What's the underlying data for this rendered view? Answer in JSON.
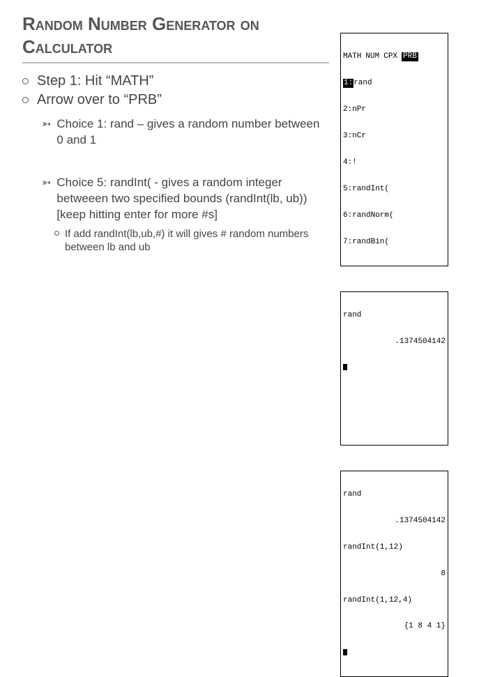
{
  "title": "Random Number Generator on Calculator",
  "steps": [
    "Step 1:  Hit “MATH”",
    "Arrow over to “PRB”"
  ],
  "choices": [
    {
      "text": "Choice 1: rand – gives a random number between 0 and 1"
    },
    {
      "text": "Choice 5: randInt( - gives a random integer betweeen two specified bounds (randInt(lb, ub))  [keep hitting enter for more #s]",
      "sub": "If add randInt(lb,ub,#) it will gives # random numbers between lb and ub"
    }
  ],
  "calc_menu": {
    "header": [
      "MATH",
      "NUM",
      "CPX",
      "PRB"
    ],
    "items": [
      "rand",
      "nPr",
      "nCr",
      "!",
      "randInt(",
      "randNorm(",
      "randBin("
    ]
  },
  "calc_rand": {
    "cmd": "rand",
    "result": ".1374504142"
  },
  "calc_randint": {
    "lines": [
      {
        "l": "rand",
        "r": ""
      },
      {
        "l": "",
        "r": ".1374504142"
      },
      {
        "l": "randInt(1,12)",
        "r": ""
      },
      {
        "l": "",
        "r": "8"
      },
      {
        "l": "randInt(1,12,4)",
        "r": ""
      },
      {
        "l": "",
        "r": "{1 8 4 1}"
      }
    ]
  }
}
